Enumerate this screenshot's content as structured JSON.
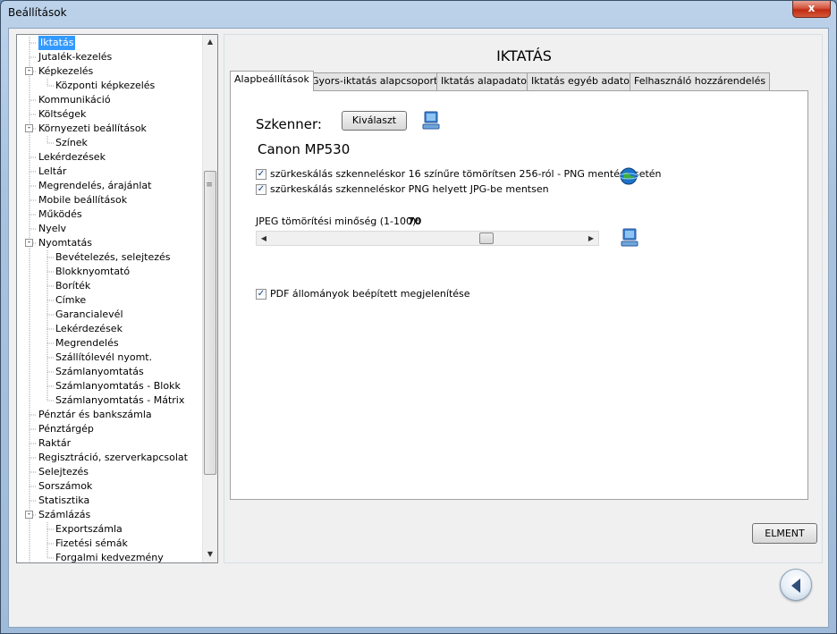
{
  "window": {
    "title": "Beállítások",
    "close_glyph": "x"
  },
  "tree": {
    "items": [
      {
        "label": "Iktatás",
        "level": 0,
        "expander": "",
        "selected": true
      },
      {
        "label": "Jutalék-kezelés",
        "level": 0,
        "expander": ""
      },
      {
        "label": "Képkezelés",
        "level": 0,
        "expander": "-"
      },
      {
        "label": "Központi képkezelés",
        "level": 1,
        "expander": ""
      },
      {
        "label": "Kommunikáció",
        "level": 0,
        "expander": ""
      },
      {
        "label": "Költségek",
        "level": 0,
        "expander": ""
      },
      {
        "label": "Környezeti beállítások",
        "level": 0,
        "expander": "-"
      },
      {
        "label": "Színek",
        "level": 1,
        "expander": ""
      },
      {
        "label": "Lekérdezések",
        "level": 0,
        "expander": ""
      },
      {
        "label": "Leltár",
        "level": 0,
        "expander": ""
      },
      {
        "label": "Megrendelés, árajánlat",
        "level": 0,
        "expander": ""
      },
      {
        "label": "Mobile beállítások",
        "level": 0,
        "expander": ""
      },
      {
        "label": "Működés",
        "level": 0,
        "expander": ""
      },
      {
        "label": "Nyelv",
        "level": 0,
        "expander": ""
      },
      {
        "label": "Nyomtatás",
        "level": 0,
        "expander": "-"
      },
      {
        "label": "Bevételezés, selejtezés",
        "level": 1,
        "expander": ""
      },
      {
        "label": "Blokknyomtató",
        "level": 1,
        "expander": ""
      },
      {
        "label": "Boríték",
        "level": 1,
        "expander": ""
      },
      {
        "label": "Címke",
        "level": 1,
        "expander": ""
      },
      {
        "label": "Garancialevél",
        "level": 1,
        "expander": ""
      },
      {
        "label": "Lekérdezések",
        "level": 1,
        "expander": ""
      },
      {
        "label": "Megrendelés",
        "level": 1,
        "expander": ""
      },
      {
        "label": "Szállítólevél nyomt.",
        "level": 1,
        "expander": ""
      },
      {
        "label": "Számlanyomtatás",
        "level": 1,
        "expander": ""
      },
      {
        "label": "Számlanyomtatás - Blokk",
        "level": 1,
        "expander": ""
      },
      {
        "label": "Számlanyomtatás - Mátrix",
        "level": 1,
        "expander": ""
      },
      {
        "label": "Pénztár és bankszámla",
        "level": 0,
        "expander": ""
      },
      {
        "label": "Pénztárgép",
        "level": 0,
        "expander": ""
      },
      {
        "label": "Raktár",
        "level": 0,
        "expander": ""
      },
      {
        "label": "Regisztráció, szerverkapcsolat",
        "level": 0,
        "expander": ""
      },
      {
        "label": "Selejtezés",
        "level": 0,
        "expander": ""
      },
      {
        "label": "Sorszámok",
        "level": 0,
        "expander": ""
      },
      {
        "label": "Statisztika",
        "level": 0,
        "expander": ""
      },
      {
        "label": "Számlázás",
        "level": 0,
        "expander": "-"
      },
      {
        "label": "Exportszámla",
        "level": 1,
        "expander": ""
      },
      {
        "label": "Fizetési sémák",
        "level": 1,
        "expander": ""
      },
      {
        "label": "Forgalmi kedvezmény",
        "level": 1,
        "expander": ""
      }
    ],
    "scroll_up_glyph": "▲",
    "scroll_down_glyph": "▼",
    "scroll_position": 0.28
  },
  "main": {
    "title": "IKTATÁS",
    "tabs": [
      {
        "label": "Alapbeállítások",
        "active": true
      },
      {
        "label": "Gyors-iktatás alapcsoportjai",
        "active": false
      },
      {
        "label": "Iktatás alapadatok",
        "active": false
      },
      {
        "label": "Iktatás egyéb adatok",
        "active": false
      },
      {
        "label": "Felhasználó hozzárendelés",
        "active": false
      }
    ],
    "scanner_label": "Szkenner:",
    "select_button": "Kiválaszt",
    "device_name": "Canon MP530",
    "checkboxes": [
      {
        "label": "szürkeskálás szkenneléskor 16 színűre tömörítsen 256-ról - PNG mentés esetén",
        "checked": true
      },
      {
        "label": "szürkeskálás szkenneléskor PNG helyett JPG-be mentsen",
        "checked": true
      },
      {
        "label": "PDF állományok beépített megjelenítése",
        "checked": true
      }
    ],
    "jpeg_quality_label": "JPEG tömörítési minőség (1-100):",
    "jpeg_quality_value": "70",
    "jpeg_quality": 70,
    "save_button": "ELMENT"
  },
  "icons": {
    "monitor": "monitor-icon",
    "globe": "globe-icon",
    "back": "back-arrow-icon"
  },
  "colors": {
    "selection": "#3399ff",
    "close_button": "#c12b12"
  }
}
